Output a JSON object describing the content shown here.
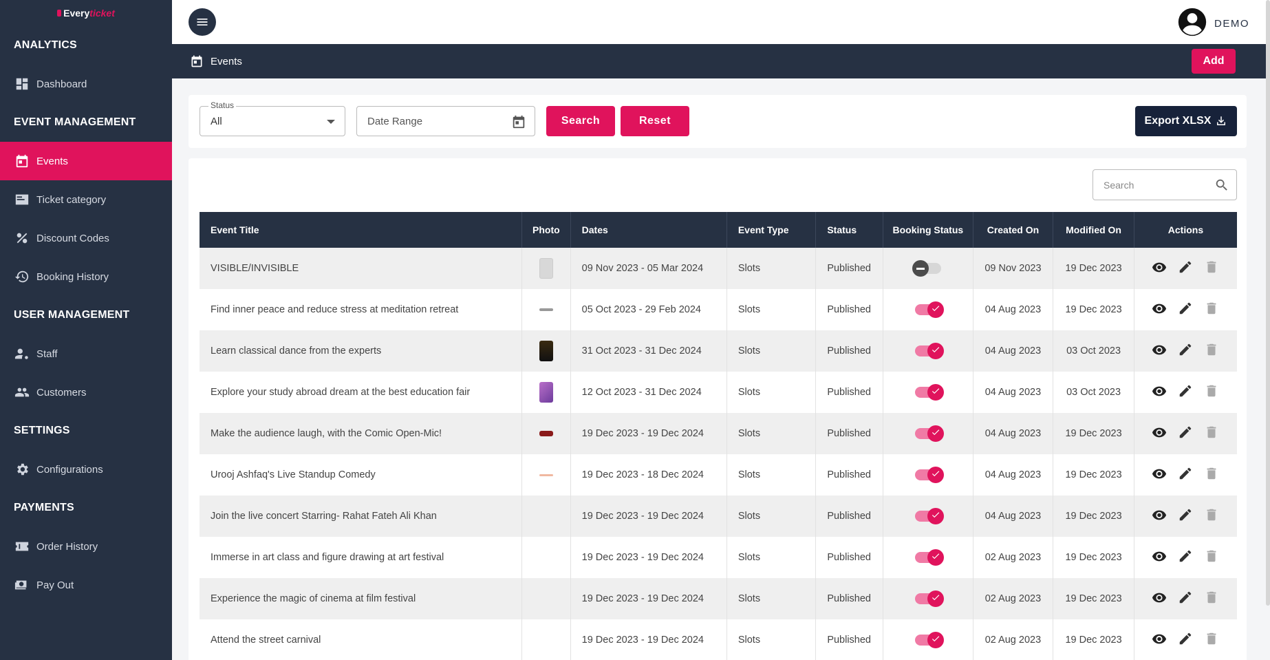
{
  "brand": {
    "logo_part1": "Every",
    "logo_part2": "ticket"
  },
  "sidebar": {
    "sections": [
      {
        "heading": "ANALYTICS",
        "items": [
          {
            "label": "Dashboard",
            "icon": "dashboard-icon"
          }
        ]
      },
      {
        "heading": "EVENT MANAGEMENT",
        "items": [
          {
            "label": "Events",
            "icon": "calendar-icon",
            "active": true
          },
          {
            "label": "Ticket category",
            "icon": "ticket-category-icon"
          },
          {
            "label": "Discount Codes",
            "icon": "percent-icon"
          },
          {
            "label": "Booking History",
            "icon": "history-icon"
          }
        ]
      },
      {
        "heading": "USER MANAGEMENT",
        "items": [
          {
            "label": "Staff",
            "icon": "staff-icon"
          },
          {
            "label": "Customers",
            "icon": "customers-icon"
          }
        ]
      },
      {
        "heading": "SETTINGS",
        "items": [
          {
            "label": "Configurations",
            "icon": "gear-icon"
          }
        ]
      },
      {
        "heading": "PAYMENTS",
        "items": [
          {
            "label": "Order History",
            "icon": "order-history-icon"
          },
          {
            "label": "Pay Out",
            "icon": "payout-icon"
          }
        ]
      }
    ]
  },
  "header": {
    "user_name": "DEMO"
  },
  "page": {
    "title": "Events",
    "add_label": "Add"
  },
  "filters": {
    "status_label": "Status",
    "status_value": "All",
    "date_placeholder": "Date Range",
    "search_label": "Search",
    "reset_label": "Reset",
    "export_label": "Export XLSX"
  },
  "table": {
    "search_placeholder": "Search",
    "columns": [
      "Event Title",
      "Photo",
      "Dates",
      "Event Type",
      "Status",
      "Booking Status",
      "Created On",
      "Modified On",
      "Actions"
    ],
    "rows": [
      {
        "title": "VISIBLE/INVISIBLE",
        "dates": "09 Nov 2023 - 05 Mar 2024",
        "type": "Slots",
        "status": "Published",
        "booking": false,
        "created": "09 Nov 2023",
        "modified": "19 Dec 2023",
        "thumb": "t1"
      },
      {
        "title": "Find inner peace and reduce stress at meditation retreat",
        "dates": "05 Oct 2023 - 29 Feb 2024",
        "type": "Slots",
        "status": "Published",
        "booking": true,
        "created": "04 Aug 2023",
        "modified": "19 Dec 2023",
        "thumb": "t2"
      },
      {
        "title": "Learn classical dance from the experts",
        "dates": "31 Oct 2023 - 31 Dec 2024",
        "type": "Slots",
        "status": "Published",
        "booking": true,
        "created": "04 Aug 2023",
        "modified": "03 Oct 2023",
        "thumb": "t3"
      },
      {
        "title": "Explore your study abroad dream at the best education fair",
        "dates": "12 Oct 2023 - 31 Dec 2024",
        "type": "Slots",
        "status": "Published",
        "booking": true,
        "created": "04 Aug 2023",
        "modified": "03 Oct 2023",
        "thumb": "t4"
      },
      {
        "title": "Make the audience laugh, with the Comic Open-Mic!",
        "dates": "19 Dec 2023 - 19 Dec 2024",
        "type": "Slots",
        "status": "Published",
        "booking": true,
        "created": "04 Aug 2023",
        "modified": "19 Dec 2023",
        "thumb": "t5"
      },
      {
        "title": "Urooj Ashfaq's Live Standup Comedy",
        "dates": "19 Dec 2023 - 18 Dec 2024",
        "type": "Slots",
        "status": "Published",
        "booking": true,
        "created": "04 Aug 2023",
        "modified": "19 Dec 2023",
        "thumb": "t6"
      },
      {
        "title": "Join the live concert Starring- Rahat Fateh Ali Khan",
        "dates": "19 Dec 2023 - 19 Dec 2024",
        "type": "Slots",
        "status": "Published",
        "booking": true,
        "created": "04 Aug 2023",
        "modified": "19 Dec 2023",
        "thumb": ""
      },
      {
        "title": "Immerse in art class and figure drawing at art festival",
        "dates": "19 Dec 2023 - 19 Dec 2024",
        "type": "Slots",
        "status": "Published",
        "booking": true,
        "created": "02 Aug 2023",
        "modified": "19 Dec 2023",
        "thumb": ""
      },
      {
        "title": "Experience the magic of cinema at film festival",
        "dates": "19 Dec 2023 - 19 Dec 2024",
        "type": "Slots",
        "status": "Published",
        "booking": true,
        "created": "02 Aug 2023",
        "modified": "19 Dec 2023",
        "thumb": ""
      },
      {
        "title": "Attend the street carnival",
        "dates": "19 Dec 2023 - 19 Dec 2024",
        "type": "Slots",
        "status": "Published",
        "booking": true,
        "created": "02 Aug 2023",
        "modified": "19 Dec 2023",
        "thumb": ""
      }
    ]
  },
  "colors": {
    "accent": "#e0135c",
    "sidebar_bg": "#263143",
    "export_bg": "#17223a"
  }
}
